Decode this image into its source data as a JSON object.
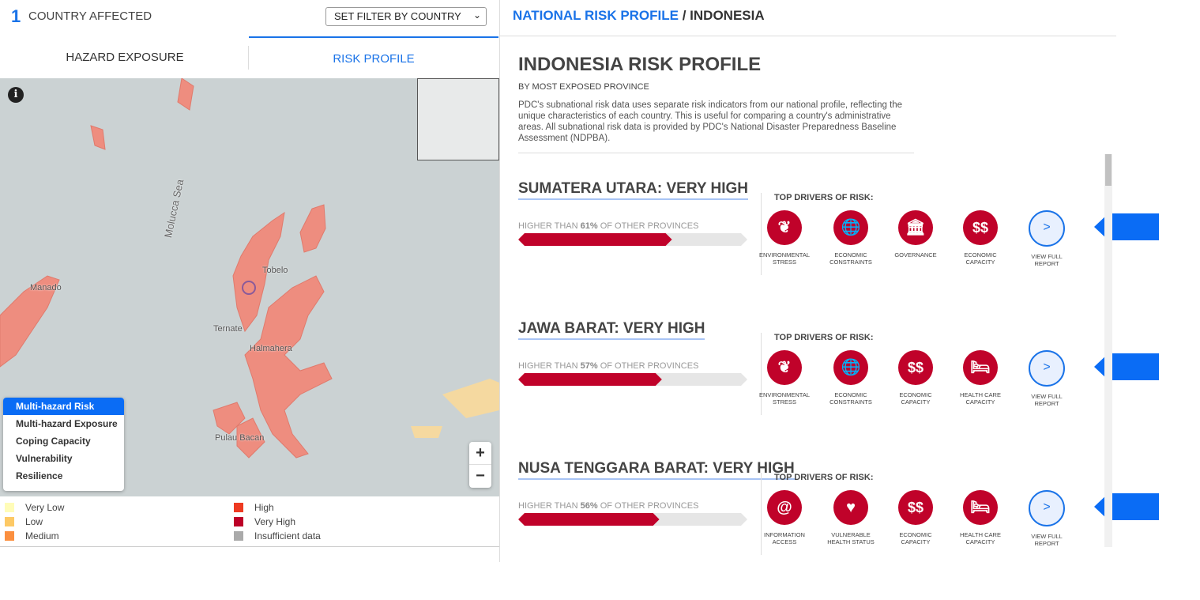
{
  "header": {
    "count": "1",
    "count_label": "COUNTRY AFFECTED",
    "filter": "SET FILTER BY COUNTRY"
  },
  "tabs": [
    {
      "label": "HAZARD EXPOSURE",
      "active": false
    },
    {
      "label": "RISK PROFILE",
      "active": true
    }
  ],
  "map": {
    "labels": {
      "sea": "Molucca Sea",
      "manado": "Manado",
      "tobelo": "Tobelo",
      "ternate": "Ternate",
      "halmahera": "Halmahera",
      "bacan": "Pulau Bacan"
    },
    "layers": [
      "Multi-hazard Risk",
      "Multi-hazard Exposure",
      "Coping Capacity",
      "Vulnerability",
      "Resilience"
    ],
    "selected_layer": "Multi-hazard Risk",
    "zoom_in": "+",
    "zoom_out": "−",
    "info": "i"
  },
  "legend": [
    {
      "label": "Very Low",
      "color": "#fffcb8"
    },
    {
      "label": "Low",
      "color": "#fdc965"
    },
    {
      "label": "Medium",
      "color": "#fb8f3f"
    },
    {
      "label": "High",
      "color": "#ee3a21"
    },
    {
      "label": "Very High",
      "color": "#bd0027"
    },
    {
      "label": "Insufficient data",
      "color": "#aaaaaa"
    }
  ],
  "right": {
    "breadcrumb_link": "NATIONAL RISK PROFILE",
    "breadcrumb_sep": " / ",
    "breadcrumb_current": "INDONESIA",
    "title": "INDONESIA RISK PROFILE",
    "subtitle": "BY MOST EXPOSED PROVINCE",
    "description": "PDC's subnational risk data uses separate risk indicators from our national profile, reflecting the unique characteristics of each country. This is useful for comparing a country's administrative areas. All subnational risk data is provided by PDC's National Disaster Preparedness Baseline Assessment (NDPBA).",
    "drivers_label": "TOP DRIVERS OF RISK:",
    "view_label": "VIEW FULL REPORT",
    "pct_prefix": "HIGHER THAN ",
    "pct_suffix": " OF OTHER PROVINCES",
    "provinces": [
      {
        "title": "SUMATERA UTARA: VERY HIGH",
        "percent": "61%",
        "value": 61,
        "drivers": [
          {
            "label": "ENVIRONMENTAL STRESS",
            "icon": "leaf-icon"
          },
          {
            "label": "ECONOMIC CONSTRAINTS",
            "icon": "globe-dollar-icon"
          },
          {
            "label": "GOVERNANCE",
            "icon": "government-building-icon"
          },
          {
            "label": "ECONOMIC CAPACITY",
            "icon": "dollar-icon"
          }
        ]
      },
      {
        "title": "JAWA BARAT: VERY HIGH",
        "percent": "57%",
        "value": 57,
        "drivers": [
          {
            "label": "ENVIRONMENTAL STRESS",
            "icon": "leaf-icon"
          },
          {
            "label": "ECONOMIC CONSTRAINTS",
            "icon": "globe-dollar-icon"
          },
          {
            "label": "ECONOMIC CAPACITY",
            "icon": "dollar-icon"
          },
          {
            "label": "HEALTH CARE CAPACITY",
            "icon": "hospital-bed-icon"
          }
        ]
      },
      {
        "title": "NUSA TENGGARA BARAT: VERY HIGH",
        "percent": "56%",
        "value": 56,
        "drivers": [
          {
            "label": "INFORMATION ACCESS",
            "icon": "books-at-icon"
          },
          {
            "label": "VULNERABLE HEALTH STATUS",
            "icon": "heart-pulse-icon"
          },
          {
            "label": "ECONOMIC CAPACITY",
            "icon": "dollar-icon"
          },
          {
            "label": "HEALTH CARE CAPACITY",
            "icon": "hospital-bed-icon"
          }
        ]
      }
    ]
  }
}
